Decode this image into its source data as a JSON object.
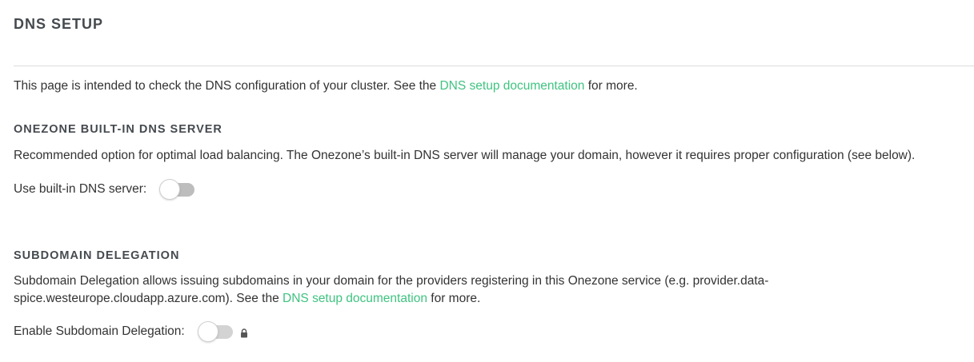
{
  "page_title": "DNS SETUP",
  "intro": {
    "text_before": "This page is intended to check the DNS configuration of your cluster. See the ",
    "link": "DNS setup documentation",
    "text_after": " for more."
  },
  "builtin_dns": {
    "title": "ONEZONE BUILT-IN DNS SERVER",
    "description": "Recommended option for optimal load balancing. The Onezone’s built-in DNS server will manage your domain, however it requires proper configuration (see below).",
    "toggle_label": "Use built-in DNS server:",
    "toggle_state": "off"
  },
  "subdomain_delegation": {
    "title": "SUBDOMAIN DELEGATION",
    "description_line1": "Subdomain Delegation allows issuing subdomains in your domain for the providers registering in this Onezone service (e.g. provider.data-",
    "description_line2_before": "spice.westeurope.cloudapp.azure.com). See the ",
    "description_link": "DNS setup documentation",
    "description_line2_after": " for more.",
    "toggle_label": "Enable Subdomain Delegation:",
    "toggle_state": "off",
    "lock_icon": "lock-icon"
  },
  "colors": {
    "link": "#3fc380",
    "heading": "#454a4f",
    "toggle_track": "#bdbdbd"
  }
}
